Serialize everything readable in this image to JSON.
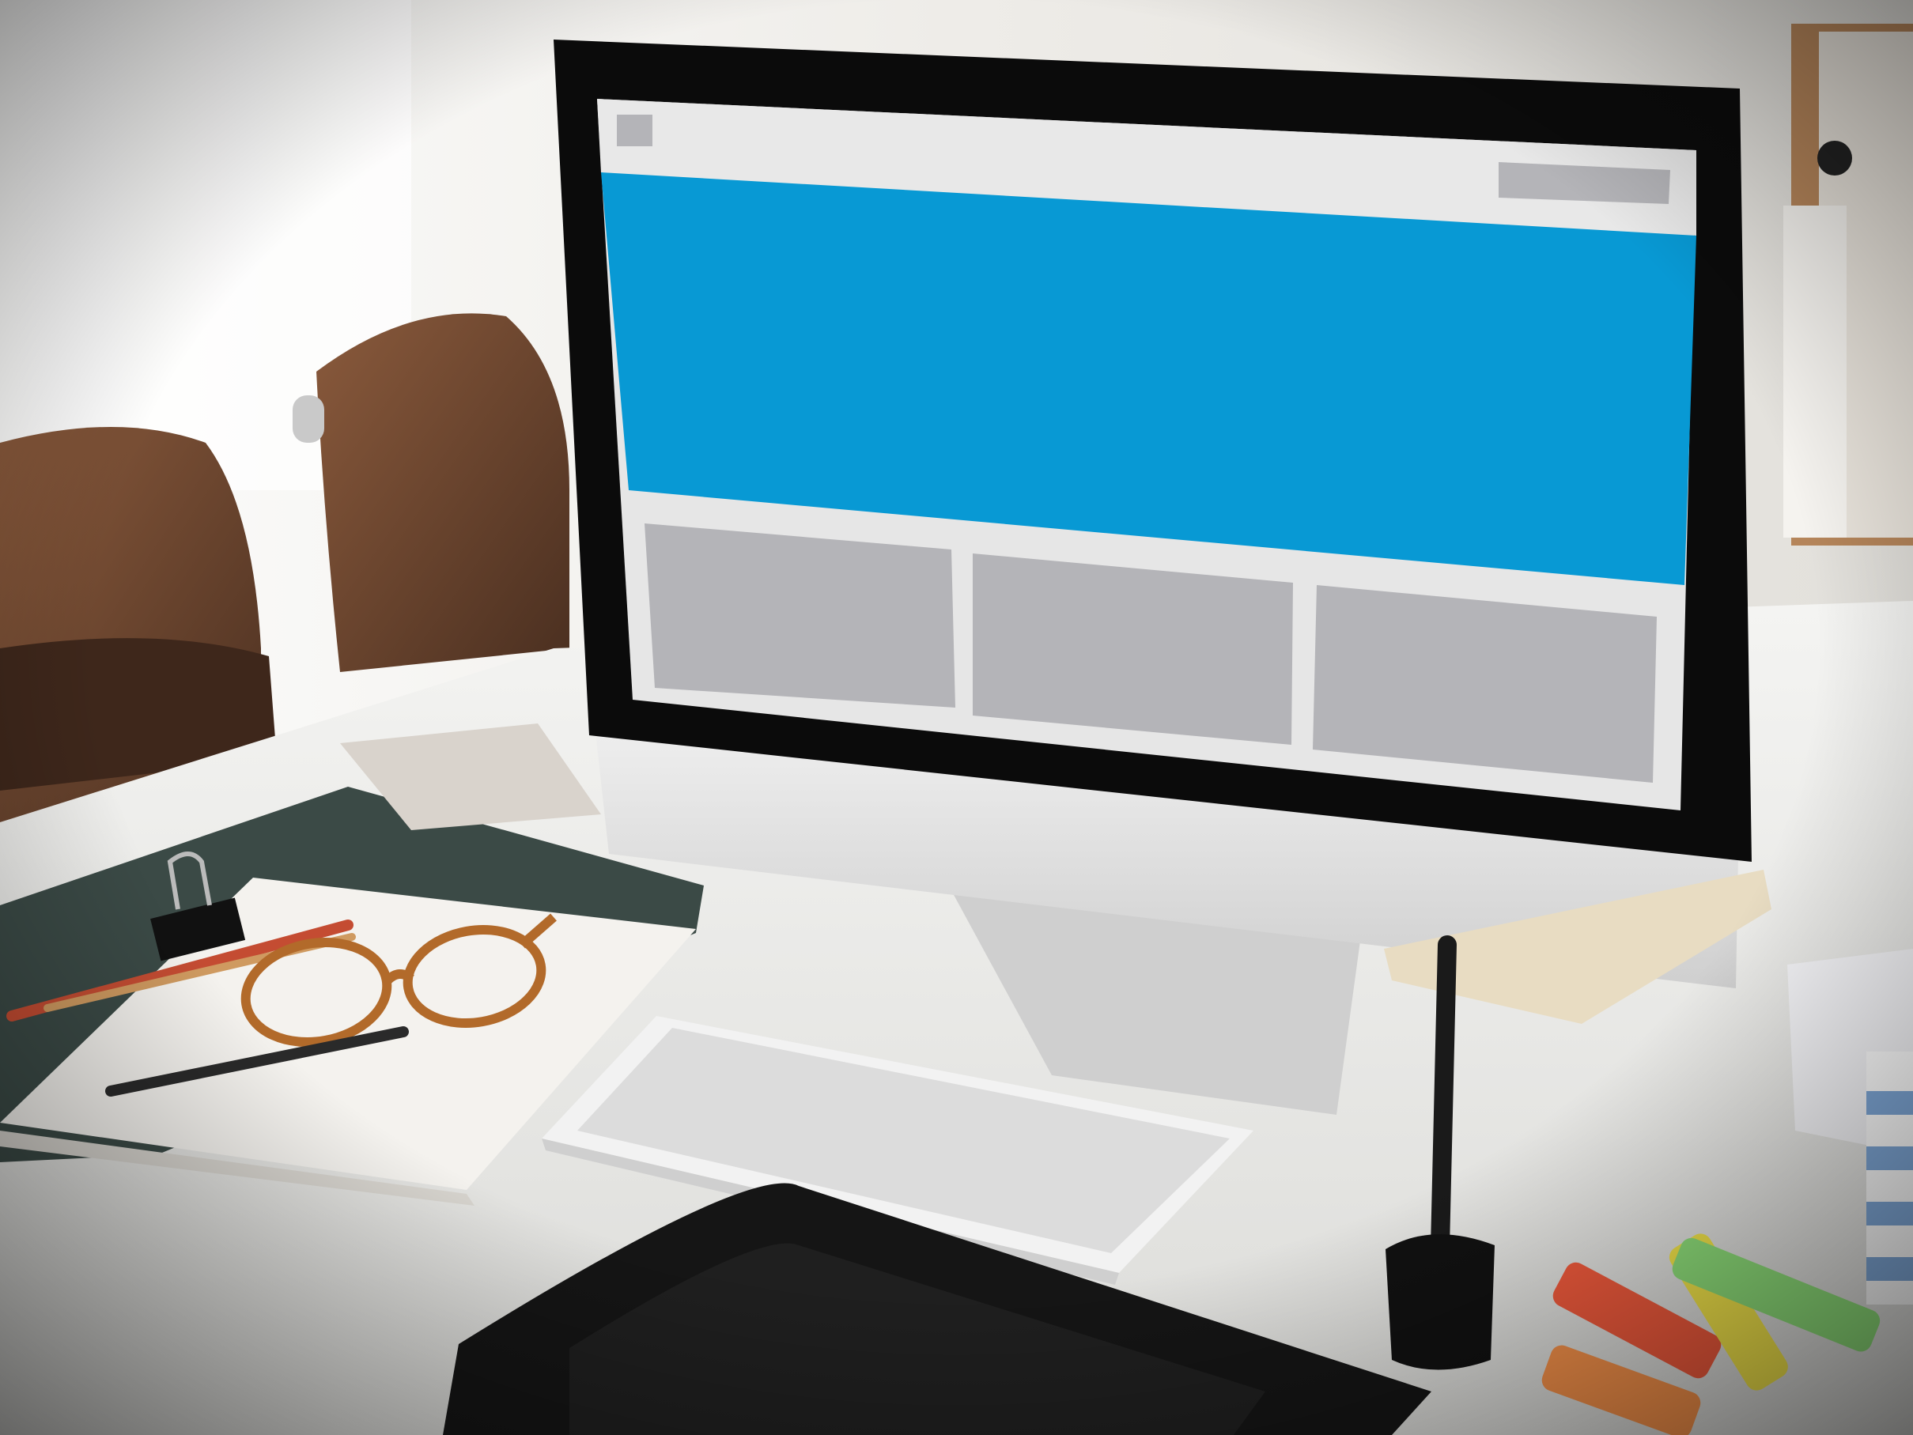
{
  "scene": {
    "colors": {
      "wall": "#f3f2ef",
      "window_light": "#fbfbf9",
      "chair": "#6b4630",
      "desk": "#eeeeec",
      "monitor_bezel": "#0b0b0b",
      "monitor_body": "#dedede",
      "screen_header": "#e8e8e8",
      "screen_banner": "#0899d4",
      "screen_card": "#b4b4b8",
      "screen_background": "#e6e6e6",
      "folder": "#3a4a46",
      "paper": "#f4f2ee",
      "tablet": "#151515",
      "keyboard": "#f2f2f2"
    },
    "objects": [
      "desktop-monitor",
      "wireframe-website-mockup",
      "wireless-keyboard",
      "graphics-tablet",
      "stylus-pen-in-holder",
      "eyeglasses",
      "notebook",
      "pencils",
      "binder-clip",
      "highlighter-markers",
      "office-chairs",
      "binder-folder",
      "striped-mug"
    ]
  }
}
